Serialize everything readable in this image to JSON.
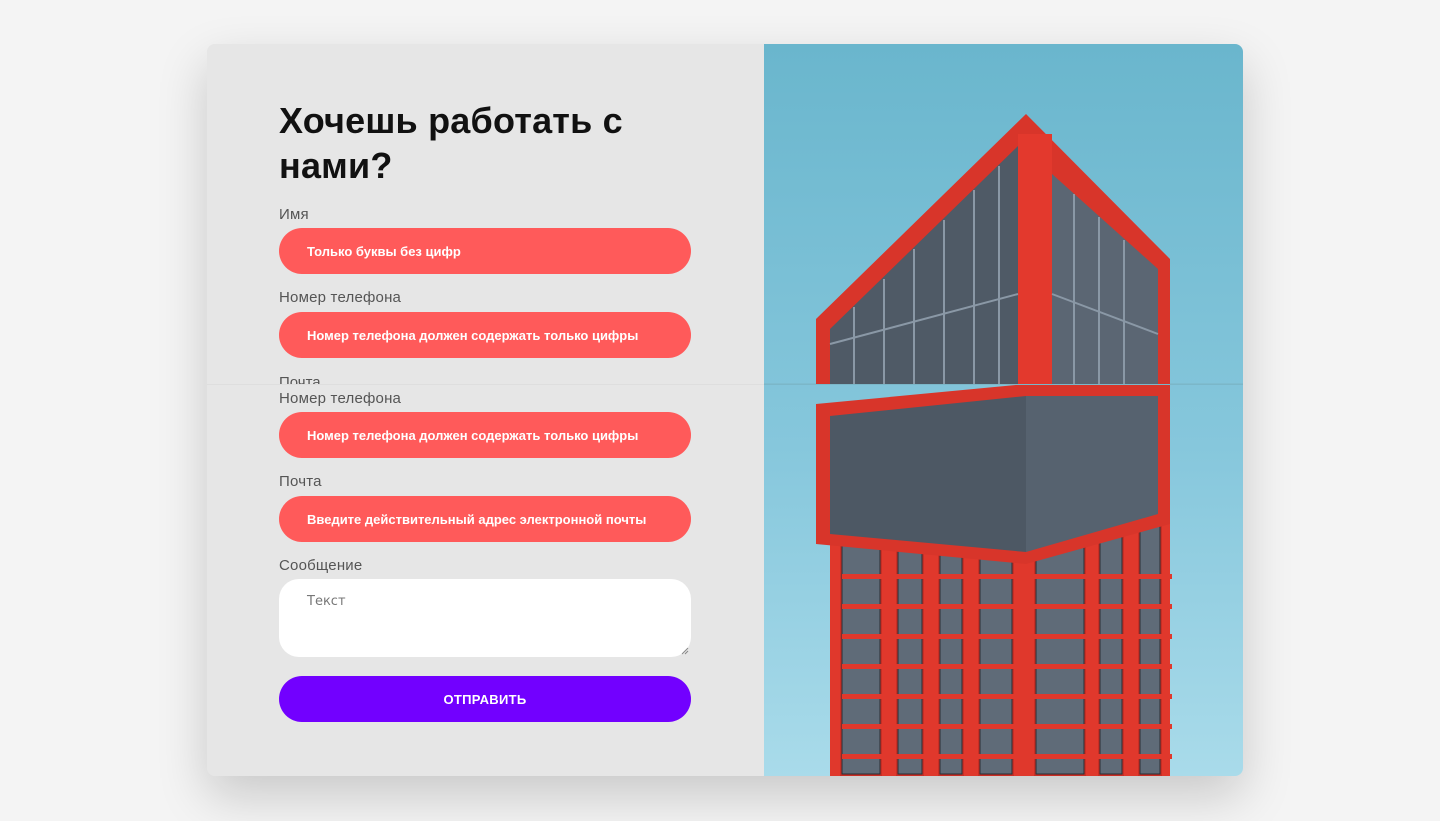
{
  "form": {
    "title": "Хочешь работать с нами?",
    "fields": [
      {
        "label": "Имя",
        "value": "Только буквы без цифр"
      },
      {
        "label": "Номер телефона",
        "value": "Номер телефона должен содержать только цифры"
      },
      {
        "label": "Почта"
      },
      {
        "label": "Номер телефона",
        "value": "Номер телефона должен содержать только цифры"
      },
      {
        "label": "Почта",
        "value": "Введите действительный адрес электронной почты"
      }
    ],
    "message": {
      "label": "Сообщение",
      "placeholder": "Текст"
    },
    "submit_label": "ОТПРАВИТЬ"
  },
  "image": {
    "subject": "building-photo"
  },
  "colors": {
    "page_bg": "#f4f4f4",
    "card_bg": "#e6e6e6",
    "error_field": "#ff5a5a",
    "submit": "#7200ff",
    "sky": "#6ab6cd",
    "building": "#d8352a"
  }
}
